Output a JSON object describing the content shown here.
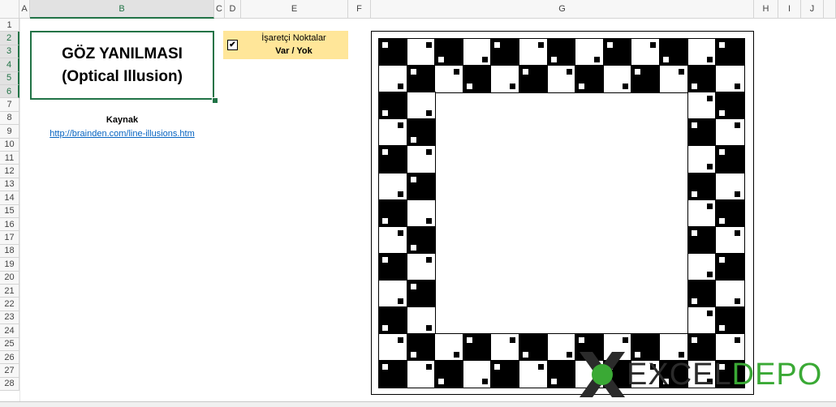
{
  "columns": [
    "A",
    "B",
    "C",
    "D",
    "E",
    "F",
    "G",
    "H",
    "I",
    "J"
  ],
  "rows": [
    "1",
    "2",
    "3",
    "4",
    "5",
    "6",
    "7",
    "8",
    "9",
    "10",
    "11",
    "12",
    "13",
    "14",
    "15",
    "16",
    "17",
    "18",
    "19",
    "20",
    "21",
    "22",
    "23",
    "24",
    "25",
    "26",
    "27",
    "28"
  ],
  "title": {
    "line1": "GÖZ YANILMASI",
    "line2": "(Optical Illusion)"
  },
  "source": {
    "label": "Kaynak",
    "url": "http://brainden.com/line-illusions.htm"
  },
  "toggle": {
    "checked_glyph": "✔",
    "line1": "İşaretçi Noktalar",
    "line2": "Var / Yok"
  },
  "illusion": {
    "tile_colors": [
      "#000000",
      "#ffffff"
    ],
    "markers": "on"
  },
  "logo": {
    "part1": "EXCEL",
    "part2": "DEPO",
    "colors": {
      "x_dark": "#2b2b2b",
      "x_green": "#3aa935",
      "excel": "#2b2b2b",
      "depo": "#3aa935"
    }
  },
  "selection_color": "#217346",
  "toggle_color": "#ffe699"
}
